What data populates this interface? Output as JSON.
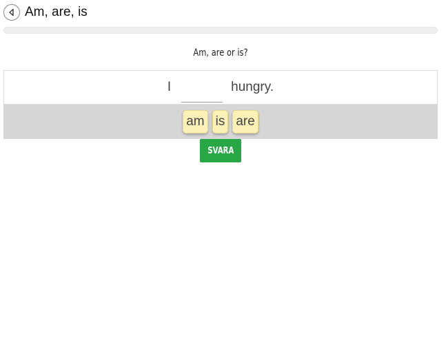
{
  "header": {
    "back_icon": "chevron-left-icon",
    "title": "Am, are, is"
  },
  "progress": {
    "fraction": 0
  },
  "exercise": {
    "question": "Am, are or is?",
    "sentence_before": "I",
    "blank_value": "",
    "sentence_after": "hungry."
  },
  "word_bank": {
    "options": [
      "am",
      "is",
      "are"
    ]
  },
  "actions": {
    "submit_label": "SVARA"
  },
  "colors": {
    "chip_background": "#fbf0b5",
    "word_bank_background": "#d6d6d6",
    "submit_button": "#28a745"
  }
}
